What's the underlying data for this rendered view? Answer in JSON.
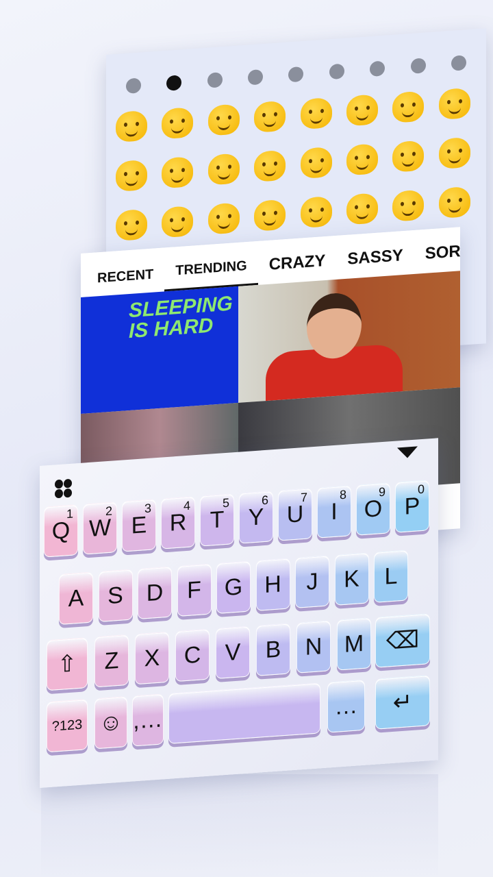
{
  "emoji_panel": {
    "tabs": [
      {
        "icon": "clock-icon",
        "active": false
      },
      {
        "icon": "smiley-icon",
        "active": true
      },
      {
        "icon": "bear-icon",
        "active": false
      },
      {
        "icon": "burger-icon",
        "active": false
      },
      {
        "icon": "car-icon",
        "active": false
      },
      {
        "icon": "football-icon",
        "active": false
      },
      {
        "icon": "lightbulb-icon",
        "active": false
      },
      {
        "icon": "symbols-icon",
        "active": false
      },
      {
        "icon": "flag-icon",
        "active": false
      }
    ],
    "emoji_count": 24
  },
  "gif_panel": {
    "tabs": [
      {
        "label": "RECENT",
        "active": false
      },
      {
        "label": "TRENDING",
        "active": true
      },
      {
        "label": "CRAZY",
        "active": false
      },
      {
        "label": "SASSY",
        "active": false
      },
      {
        "label": "SORRY",
        "active": false
      }
    ],
    "gif_text": [
      "SLEEPING",
      "IS HARD"
    ]
  },
  "keyboard": {
    "colors": {
      "pink": "#f7b6cf",
      "purple": "#c9b6f0",
      "blue": "#8dd3f4"
    },
    "rows": [
      [
        {
          "l": "Q",
          "n": "1"
        },
        {
          "l": "W",
          "n": "2"
        },
        {
          "l": "E",
          "n": "3"
        },
        {
          "l": "R",
          "n": "4"
        },
        {
          "l": "T",
          "n": "5"
        },
        {
          "l": "Y",
          "n": "6"
        },
        {
          "l": "U",
          "n": "7"
        },
        {
          "l": "I",
          "n": "8"
        },
        {
          "l": "O",
          "n": "9"
        },
        {
          "l": "P",
          "n": "0"
        }
      ],
      [
        {
          "l": "A"
        },
        {
          "l": "S"
        },
        {
          "l": "D"
        },
        {
          "l": "F"
        },
        {
          "l": "G"
        },
        {
          "l": "H"
        },
        {
          "l": "J"
        },
        {
          "l": "K"
        },
        {
          "l": "L"
        }
      ],
      [
        {
          "l": "⇧",
          "name": "shift-key"
        },
        {
          "l": "Z"
        },
        {
          "l": "X"
        },
        {
          "l": "C"
        },
        {
          "l": "V"
        },
        {
          "l": "B"
        },
        {
          "l": "N"
        },
        {
          "l": "M"
        },
        {
          "l": "⌫",
          "name": "backspace-key"
        }
      ],
      [
        {
          "l": "?123",
          "name": "symbols-key"
        },
        {
          "l": "☺",
          "name": "emoji-key"
        },
        {
          "l": ",…",
          "name": "comma-key"
        },
        {
          "l": "",
          "name": "space-key"
        },
        {
          "l": "…",
          "name": "period-key"
        },
        {
          "l": "↵",
          "name": "enter-key"
        }
      ]
    ]
  }
}
